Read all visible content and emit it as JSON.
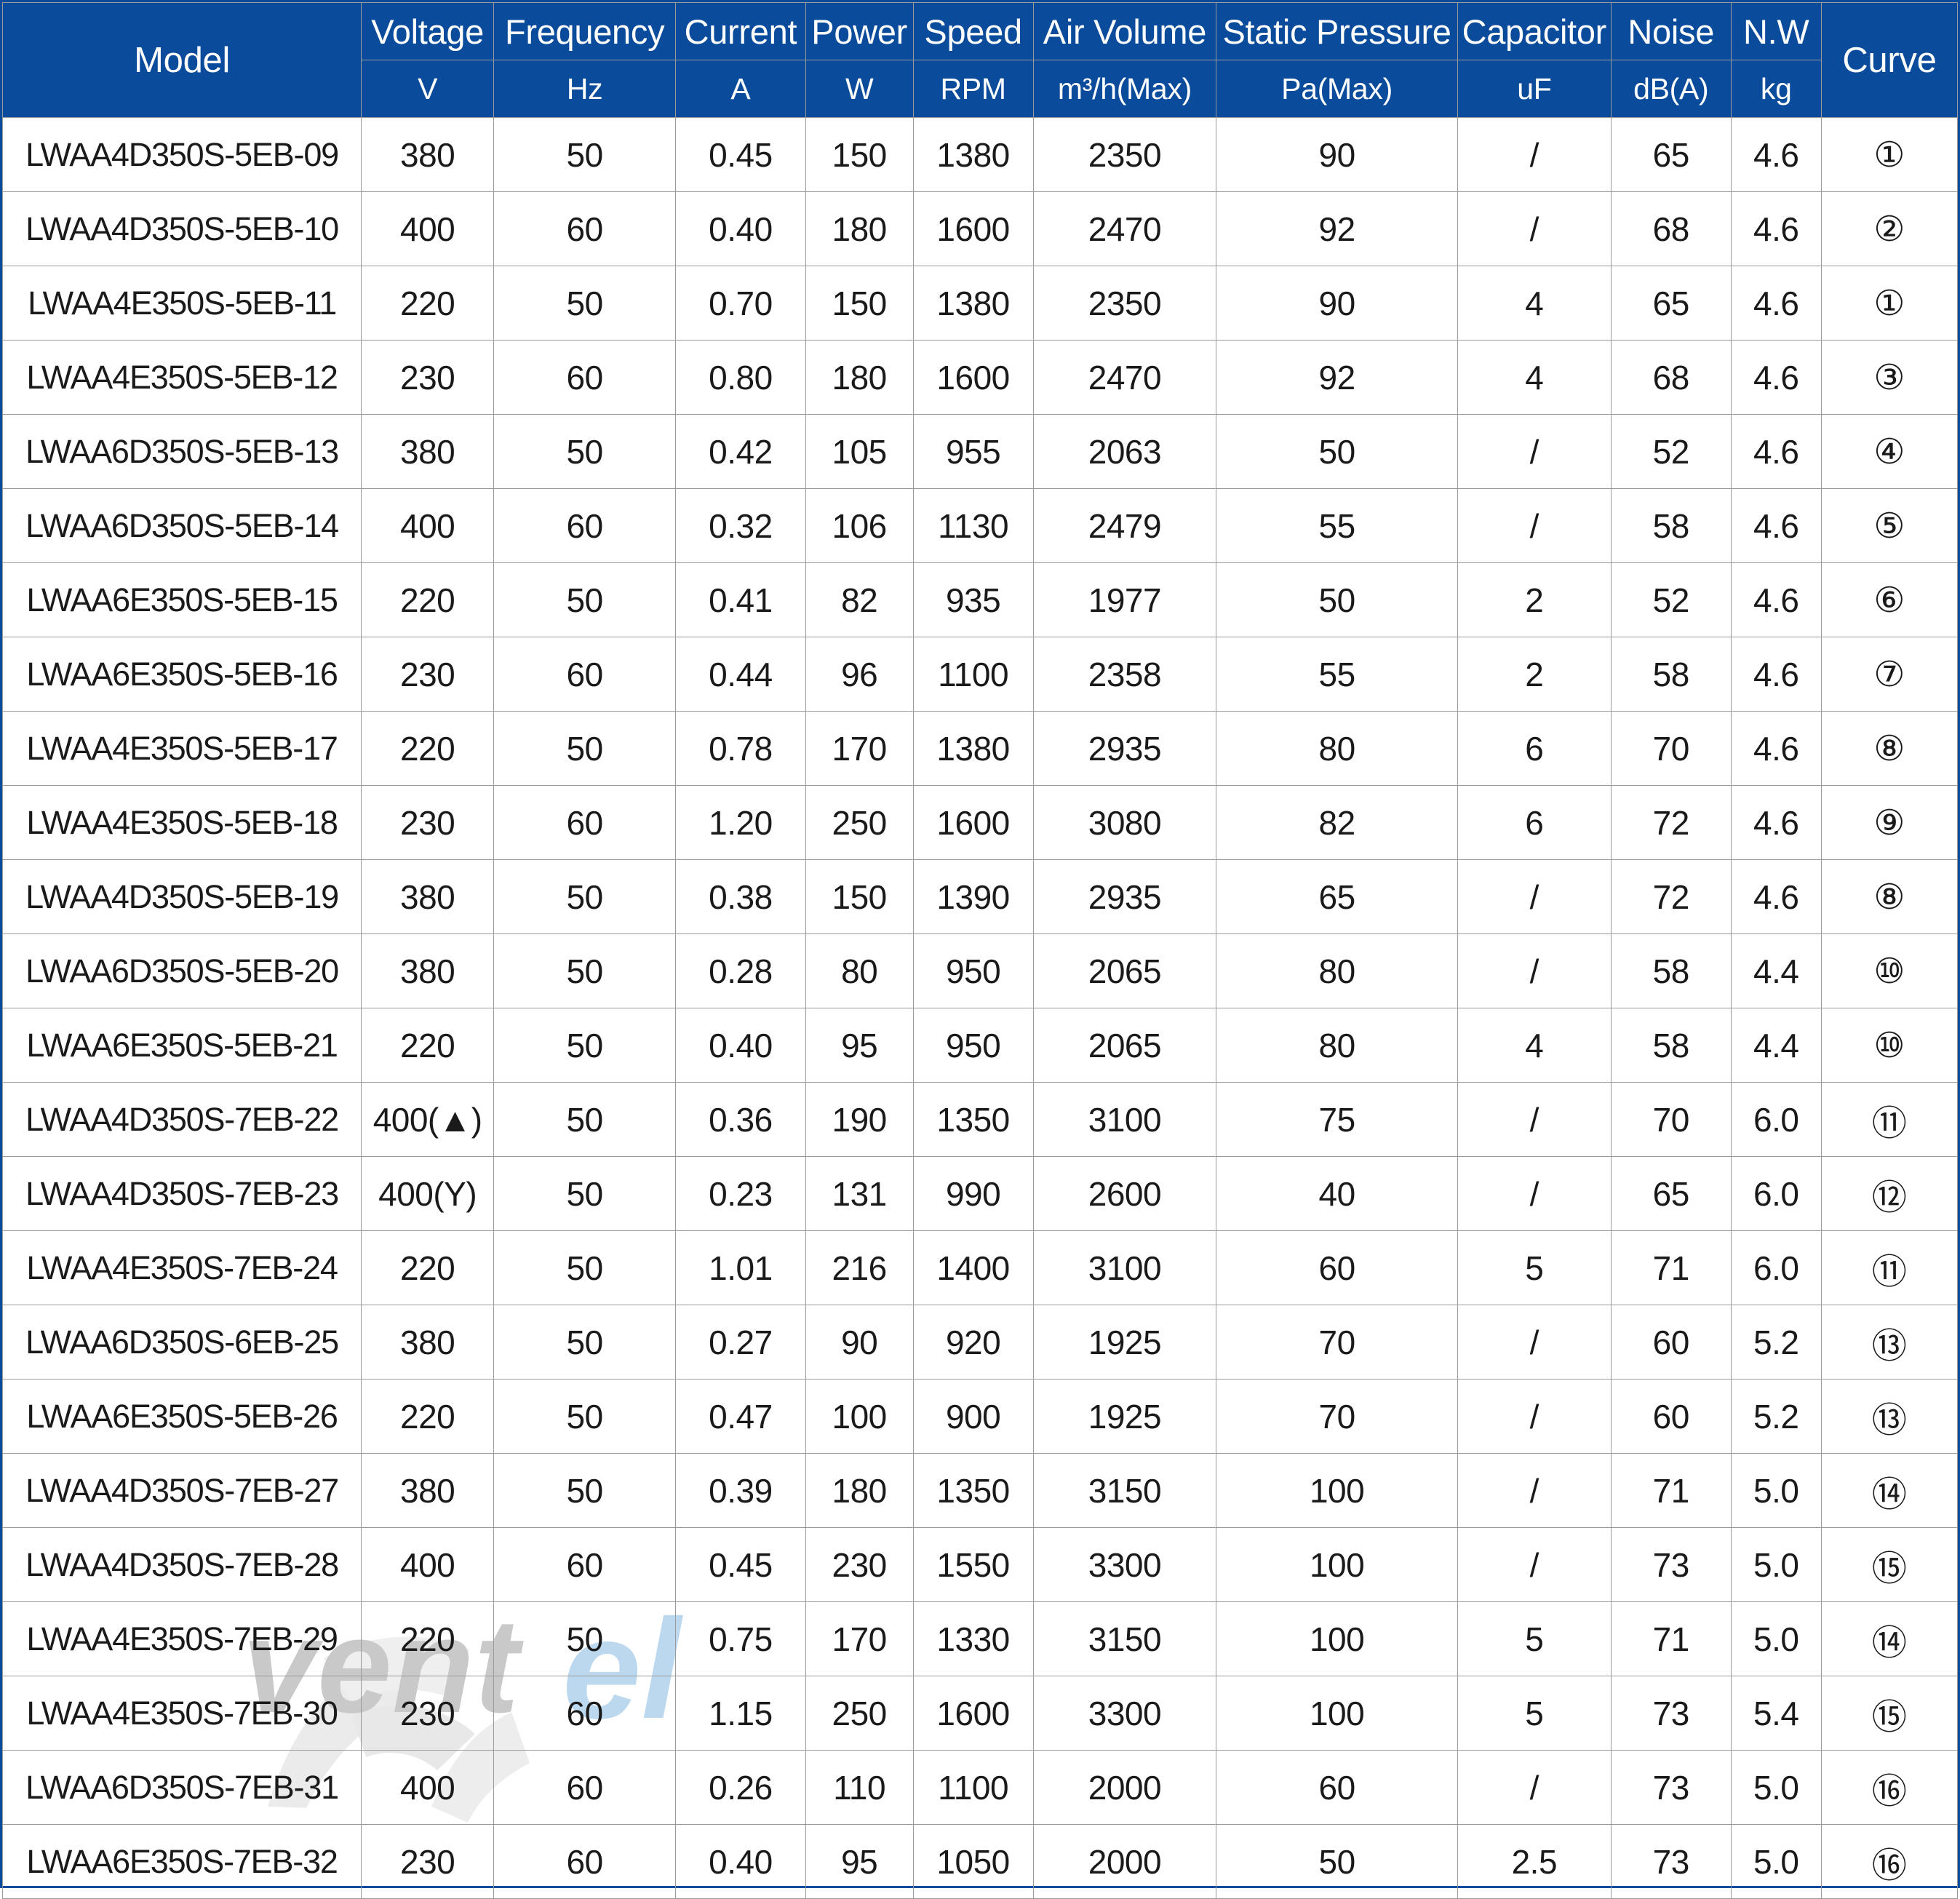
{
  "table": {
    "columns": [
      {
        "key": "model",
        "label": "Model",
        "unit": ""
      },
      {
        "key": "voltage",
        "label": "Voltage",
        "unit": "V"
      },
      {
        "key": "freq",
        "label": "Frequency",
        "unit": "Hz"
      },
      {
        "key": "current",
        "label": "Current",
        "unit": "A"
      },
      {
        "key": "power",
        "label": "Power",
        "unit": "W"
      },
      {
        "key": "speed",
        "label": "Speed",
        "unit": "RPM"
      },
      {
        "key": "air",
        "label": "Air Volume",
        "unit": "m³/h(Max)"
      },
      {
        "key": "static",
        "label": "Static Pressure",
        "unit": "Pa(Max)"
      },
      {
        "key": "cap",
        "label": "Capacitor",
        "unit": "uF"
      },
      {
        "key": "noise",
        "label": "Noise",
        "unit": "dB(A)"
      },
      {
        "key": "nw",
        "label": "N.W",
        "unit": "kg"
      },
      {
        "key": "curve",
        "label": "Curve",
        "unit": ""
      }
    ],
    "rows": [
      {
        "model": "LWAA4D350S-5EB-09",
        "voltage": "380",
        "freq": "50",
        "current": "0.45",
        "power": "150",
        "speed": "1380",
        "air": "2350",
        "static": "90",
        "cap": "/",
        "noise": "65",
        "nw": "4.6",
        "curve": "①"
      },
      {
        "model": "LWAA4D350S-5EB-10",
        "voltage": "400",
        "freq": "60",
        "current": "0.40",
        "power": "180",
        "speed": "1600",
        "air": "2470",
        "static": "92",
        "cap": "/",
        "noise": "68",
        "nw": "4.6",
        "curve": "②"
      },
      {
        "model": "LWAA4E350S-5EB-11",
        "voltage": "220",
        "freq": "50",
        "current": "0.70",
        "power": "150",
        "speed": "1380",
        "air": "2350",
        "static": "90",
        "cap": "4",
        "noise": "65",
        "nw": "4.6",
        "curve": "①"
      },
      {
        "model": "LWAA4E350S-5EB-12",
        "voltage": "230",
        "freq": "60",
        "current": "0.80",
        "power": "180",
        "speed": "1600",
        "air": "2470",
        "static": "92",
        "cap": "4",
        "noise": "68",
        "nw": "4.6",
        "curve": "③"
      },
      {
        "model": "LWAA6D350S-5EB-13",
        "voltage": "380",
        "freq": "50",
        "current": "0.42",
        "power": "105",
        "speed": "955",
        "air": "2063",
        "static": "50",
        "cap": "/",
        "noise": "52",
        "nw": "4.6",
        "curve": "④"
      },
      {
        "model": "LWAA6D350S-5EB-14",
        "voltage": "400",
        "freq": "60",
        "current": "0.32",
        "power": "106",
        "speed": "1130",
        "air": "2479",
        "static": "55",
        "cap": "/",
        "noise": "58",
        "nw": "4.6",
        "curve": "⑤"
      },
      {
        "model": "LWAA6E350S-5EB-15",
        "voltage": "220",
        "freq": "50",
        "current": "0.41",
        "power": "82",
        "speed": "935",
        "air": "1977",
        "static": "50",
        "cap": "2",
        "noise": "52",
        "nw": "4.6",
        "curve": "⑥"
      },
      {
        "model": "LWAA6E350S-5EB-16",
        "voltage": "230",
        "freq": "60",
        "current": "0.44",
        "power": "96",
        "speed": "1100",
        "air": "2358",
        "static": "55",
        "cap": "2",
        "noise": "58",
        "nw": "4.6",
        "curve": "⑦"
      },
      {
        "model": "LWAA4E350S-5EB-17",
        "voltage": "220",
        "freq": "50",
        "current": "0.78",
        "power": "170",
        "speed": "1380",
        "air": "2935",
        "static": "80",
        "cap": "6",
        "noise": "70",
        "nw": "4.6",
        "curve": "⑧"
      },
      {
        "model": "LWAA4E350S-5EB-18",
        "voltage": "230",
        "freq": "60",
        "current": "1.20",
        "power": "250",
        "speed": "1600",
        "air": "3080",
        "static": "82",
        "cap": "6",
        "noise": "72",
        "nw": "4.6",
        "curve": "⑨"
      },
      {
        "model": "LWAA4D350S-5EB-19",
        "voltage": "380",
        "freq": "50",
        "current": "0.38",
        "power": "150",
        "speed": "1390",
        "air": "2935",
        "static": "65",
        "cap": "/",
        "noise": "72",
        "nw": "4.6",
        "curve": "⑧"
      },
      {
        "model": "LWAA6D350S-5EB-20",
        "voltage": "380",
        "freq": "50",
        "current": "0.28",
        "power": "80",
        "speed": "950",
        "air": "2065",
        "static": "80",
        "cap": "/",
        "noise": "58",
        "nw": "4.4",
        "curve": "⑩"
      },
      {
        "model": "LWAA6E350S-5EB-21",
        "voltage": "220",
        "freq": "50",
        "current": "0.40",
        "power": "95",
        "speed": "950",
        "air": "2065",
        "static": "80",
        "cap": "4",
        "noise": "58",
        "nw": "4.4",
        "curve": "⑩"
      },
      {
        "model": "LWAA4D350S-7EB-22",
        "voltage": "400(▲)",
        "freq": "50",
        "current": "0.36",
        "power": "190",
        "speed": "1350",
        "air": "3100",
        "static": "75",
        "cap": "/",
        "noise": "70",
        "nw": "6.0",
        "curve": "⑪"
      },
      {
        "model": "LWAA4D350S-7EB-23",
        "voltage": "400(Y)",
        "freq": "50",
        "current": "0.23",
        "power": "131",
        "speed": "990",
        "air": "2600",
        "static": "40",
        "cap": "/",
        "noise": "65",
        "nw": "6.0",
        "curve": "⑫"
      },
      {
        "model": "LWAA4E350S-7EB-24",
        "voltage": "220",
        "freq": "50",
        "current": "1.01",
        "power": "216",
        "speed": "1400",
        "air": "3100",
        "static": "60",
        "cap": "5",
        "noise": "71",
        "nw": "6.0",
        "curve": "⑪"
      },
      {
        "model": "LWAA6D350S-6EB-25",
        "voltage": "380",
        "freq": "50",
        "current": "0.27",
        "power": "90",
        "speed": "920",
        "air": "1925",
        "static": "70",
        "cap": "/",
        "noise": "60",
        "nw": "5.2",
        "curve": "⑬"
      },
      {
        "model": "LWAA6E350S-5EB-26",
        "voltage": "220",
        "freq": "50",
        "current": "0.47",
        "power": "100",
        "speed": "900",
        "air": "1925",
        "static": "70",
        "cap": "/",
        "noise": "60",
        "nw": "5.2",
        "curve": "⑬"
      },
      {
        "model": "LWAA4D350S-7EB-27",
        "voltage": "380",
        "freq": "50",
        "current": "0.39",
        "power": "180",
        "speed": "1350",
        "air": "3150",
        "static": "100",
        "cap": "/",
        "noise": "71",
        "nw": "5.0",
        "curve": "⑭"
      },
      {
        "model": "LWAA4D350S-7EB-28",
        "voltage": "400",
        "freq": "60",
        "current": "0.45",
        "power": "230",
        "speed": "1550",
        "air": "3300",
        "static": "100",
        "cap": "/",
        "noise": "73",
        "nw": "5.0",
        "curve": "⑮"
      },
      {
        "model": "LWAA4E350S-7EB-29",
        "voltage": "220",
        "freq": "50",
        "current": "0.75",
        "power": "170",
        "speed": "1330",
        "air": "3150",
        "static": "100",
        "cap": "5",
        "noise": "71",
        "nw": "5.0",
        "curve": "⑭"
      },
      {
        "model": "LWAA4E350S-7EB-30",
        "voltage": "230",
        "freq": "60",
        "current": "1.15",
        "power": "250",
        "speed": "1600",
        "air": "3300",
        "static": "100",
        "cap": "5",
        "noise": "73",
        "nw": "5.4",
        "curve": "⑮"
      },
      {
        "model": "LWAA6D350S-7EB-31",
        "voltage": "400",
        "freq": "60",
        "current": "0.26",
        "power": "110",
        "speed": "1100",
        "air": "2000",
        "static": "60",
        "cap": "/",
        "noise": "73",
        "nw": "5.0",
        "curve": "⑯"
      },
      {
        "model": "LWAA6E350S-7EB-32",
        "voltage": "230",
        "freq": "60",
        "current": "0.40",
        "power": "95",
        "speed": "1050",
        "air": "2000",
        "static": "50",
        "cap": "2.5",
        "noise": "73",
        "nw": "5.0",
        "curve": "⑯"
      }
    ]
  },
  "watermark": {
    "text_primary": "vent",
    "text_accent": "el",
    "color_primary": "#c9c9c9",
    "color_accent": "#bcd8ef"
  },
  "colors": {
    "header_background": "#0a4b9b",
    "header_text": "#ffffff",
    "grid_line": "#9a9a9a",
    "body_text": "#1a1a1a"
  }
}
